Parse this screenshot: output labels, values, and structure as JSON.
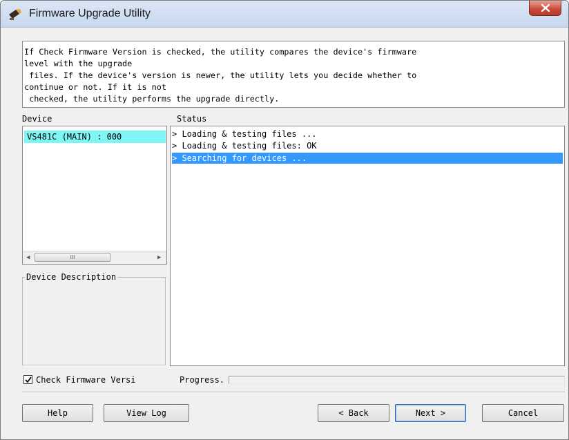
{
  "window": {
    "title": "Firmware Upgrade Utility",
    "icons": {
      "app": "firmware-plug-icon",
      "close": "close-icon"
    }
  },
  "description": "If Check Firmware Version is checked, the utility compares the device's firmware\nlevel with the upgrade\n files. If the device's version is newer, the utility lets you decide whether to\ncontinue or not. If it is not\n checked, the utility performs the upgrade directly.",
  "device": {
    "label": "Device",
    "items": [
      "VS481C (MAIN) : 000"
    ],
    "scroll_grip": "III"
  },
  "status": {
    "label": "Status",
    "lines": [
      "> Loading & testing files ...",
      "> Loading & testing files: OK",
      "> Searching for devices ..."
    ],
    "selected_index": 2
  },
  "device_description": {
    "label": "Device Description",
    "text": ""
  },
  "check_firmware": {
    "label": "Check Firmware Versi",
    "checked": true
  },
  "progress": {
    "label": "Progress.",
    "value": 0
  },
  "buttons": {
    "help": "Help",
    "view_log": "View Log",
    "back": "< Back",
    "next": "Next >",
    "cancel": "Cancel"
  },
  "colors": {
    "device_highlight": "#7ff6f6",
    "status_highlight": "#3399ff",
    "close_button": "#c9483a"
  }
}
